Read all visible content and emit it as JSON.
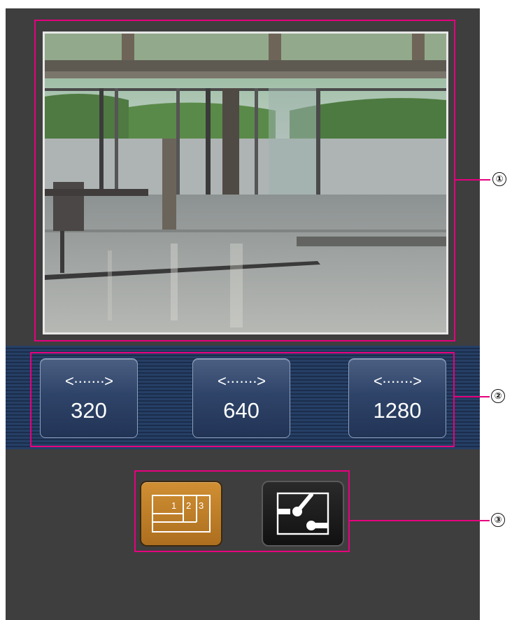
{
  "callouts": {
    "marker1": "①",
    "marker2": "②",
    "marker3": "③"
  },
  "image_size_buttons": [
    {
      "arrow": "<·······>",
      "label": "320"
    },
    {
      "arrow": "<·······>",
      "label": "640"
    },
    {
      "arrow": "<·······>",
      "label": "1280"
    }
  ],
  "bottom_buttons": {
    "multi_screen": {
      "labels": [
        "1",
        "2",
        "3"
      ]
    }
  },
  "colors": {
    "panel_bg": "#3e3e3e",
    "callout_border": "#e6007e",
    "button_blue": "#2f4469",
    "active_orange": "#c27f2b"
  }
}
